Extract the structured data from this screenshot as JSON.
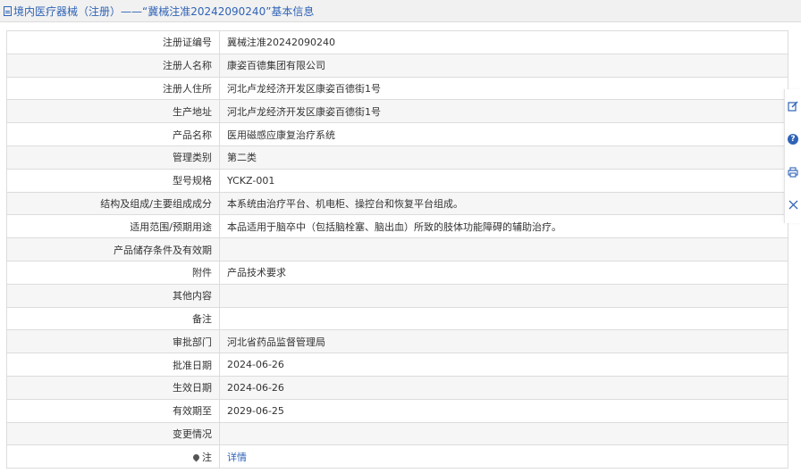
{
  "title": "境内医疗器械（注册）——“冀械注准20242090240”基本信息",
  "rows": [
    {
      "label": "注册证编号",
      "value": "冀械注准20242090240"
    },
    {
      "label": "注册人名称",
      "value": "康姿百德集团有限公司"
    },
    {
      "label": "注册人住所",
      "value": "河北卢龙经济开发区康姿百德街1号"
    },
    {
      "label": "生产地址",
      "value": "河北卢龙经济开发区康姿百德街1号"
    },
    {
      "label": "产品名称",
      "value": "医用磁感应康复治疗系统"
    },
    {
      "label": "管理类别",
      "value": "第二类"
    },
    {
      "label": "型号规格",
      "value": "YCKZ-001"
    },
    {
      "label": "结构及组成/主要组成成分",
      "value": "本系统由治疗平台、机电柜、操控台和恢复平台组成。"
    },
    {
      "label": "适用范围/预期用途",
      "value": "本品适用于脑卒中（包括脑栓塞、脑出血）所致的肢体功能障碍的辅助治疗。"
    },
    {
      "label": "产品储存条件及有效期",
      "value": ""
    },
    {
      "label": "附件",
      "value": "产品技术要求"
    },
    {
      "label": "其他内容",
      "value": ""
    },
    {
      "label": "备注",
      "value": ""
    },
    {
      "label": "审批部门",
      "value": "河北省药品监督管理局"
    },
    {
      "label": "批准日期",
      "value": "2024-06-26"
    },
    {
      "label": "生效日期",
      "value": "2024-06-26"
    },
    {
      "label": "有效期至",
      "value": "2029-06-25"
    },
    {
      "label": "变更情况",
      "value": ""
    }
  ],
  "note": {
    "label": "注",
    "link": "详情"
  },
  "side_tools": [
    "edit-icon",
    "help-icon",
    "print-icon",
    "close-icon"
  ],
  "colors": {
    "accent": "#2f63b6",
    "border": "#dcdcdc",
    "stripe": "#f6f6f6"
  }
}
